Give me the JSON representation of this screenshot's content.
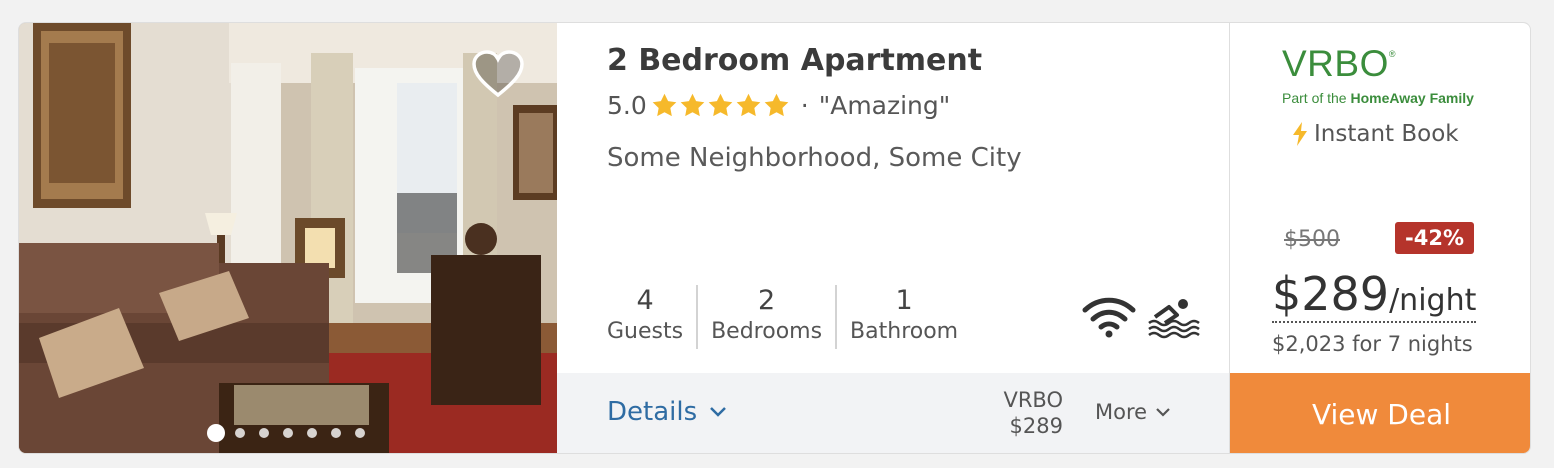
{
  "listing": {
    "title": "2 Bedroom Apartment",
    "rating": "5.0",
    "stars": 5,
    "review_label": "\"Amazing\"",
    "separator": "·",
    "location": "Some Neighborhood, Some City",
    "favorite_icon": "heart-outline-icon",
    "photo_count": 7,
    "active_photo": 1
  },
  "stats": [
    {
      "value": "4",
      "label": "Guests"
    },
    {
      "value": "2",
      "label": "Bedrooms"
    },
    {
      "value": "1",
      "label": "Bathroom"
    }
  ],
  "amenities": [
    "wifi-icon",
    "pool-icon"
  ],
  "footer": {
    "details_label": "Details",
    "provider_name": "VRBO",
    "provider_price": "$289",
    "more_label": "More"
  },
  "pricing": {
    "brand": "VRBO",
    "brand_mark": "®",
    "brand_tagline_prefix": "Part of the ",
    "brand_tagline_bold": "HomeAway Family",
    "instant_book": "Instant Book",
    "original_price": "$500",
    "discount": "-42%",
    "price": "$289",
    "per": "/night",
    "total": "$2,023 for 7 nights",
    "cta": "View Deal"
  },
  "colors": {
    "accent": "#f08a3b",
    "link": "#2f6ca3",
    "star": "#f6b92b",
    "brand": "#3b8d3c",
    "discount": "#b5342b"
  }
}
